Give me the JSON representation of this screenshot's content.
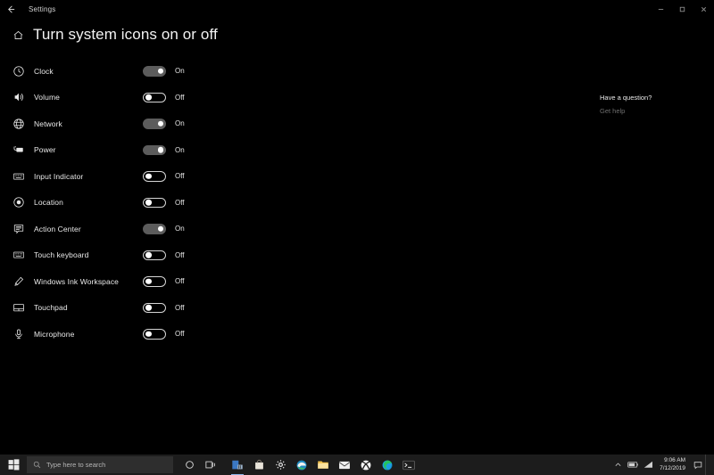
{
  "window": {
    "title": "Settings",
    "back_icon": "back-arrow-icon",
    "controls": [
      {
        "name": "minimize-button",
        "icon": "minimize-icon"
      },
      {
        "name": "maximize-button",
        "icon": "maximize-icon"
      },
      {
        "name": "close-button",
        "icon": "close-icon"
      }
    ]
  },
  "header": {
    "home_icon": "home-icon",
    "title": "Turn system icons on or off"
  },
  "settings": {
    "rows": [
      {
        "icon": "clock-icon",
        "label": "Clock",
        "state": "On",
        "on": true
      },
      {
        "icon": "volume-icon",
        "label": "Volume",
        "state": "Off",
        "on": false
      },
      {
        "icon": "network-globe-icon",
        "label": "Network",
        "state": "On",
        "on": true
      },
      {
        "icon": "power-battery-icon",
        "label": "Power",
        "state": "On",
        "on": true
      },
      {
        "icon": "keyboard-icon",
        "label": "Input Indicator",
        "state": "Off",
        "on": false
      },
      {
        "icon": "location-icon",
        "label": "Location",
        "state": "Off",
        "on": false
      },
      {
        "icon": "action-center-icon",
        "label": "Action Center",
        "state": "On",
        "on": true
      },
      {
        "icon": "touch-keyboard-icon",
        "label": "Touch keyboard",
        "state": "Off",
        "on": false
      },
      {
        "icon": "pen-icon",
        "label": "Windows Ink Workspace",
        "state": "Off",
        "on": false
      },
      {
        "icon": "touchpad-icon",
        "label": "Touchpad",
        "state": "Off",
        "on": false
      },
      {
        "icon": "microphone-icon",
        "label": "Microphone",
        "state": "Off",
        "on": false
      }
    ]
  },
  "help": {
    "title": "Have a question?",
    "link": "Get help"
  },
  "taskbar": {
    "start_icon": "windows-start-icon",
    "search_placeholder": "Type here to search",
    "cortana_icon": "cortana-icon",
    "taskview_icon": "task-view-icon",
    "apps": [
      {
        "name": "taskbar-store-icon",
        "icon": "microsoft-store-icon"
      },
      {
        "name": "taskbar-bag-icon",
        "icon": "shopping-bag-icon"
      },
      {
        "name": "taskbar-settings-icon",
        "icon": "gear-icon"
      },
      {
        "name": "taskbar-edge-legacy-icon",
        "icon": "edge-legacy-icon"
      },
      {
        "name": "taskbar-explorer-icon",
        "icon": "file-explorer-icon"
      },
      {
        "name": "taskbar-mail-icon",
        "icon": "mail-icon"
      },
      {
        "name": "taskbar-xbox-icon",
        "icon": "xbox-icon"
      },
      {
        "name": "taskbar-edge-icon",
        "icon": "edge-chromium-icon"
      },
      {
        "name": "taskbar-terminal-icon",
        "icon": "terminal-icon"
      }
    ],
    "tray": [
      {
        "name": "show-hidden-icons-button",
        "icon": "chevron-up-icon"
      },
      {
        "name": "battery-icon",
        "icon": "battery-icon"
      },
      {
        "name": "network-tray-icon",
        "icon": "network-icon"
      }
    ],
    "clock_time": "9:06 AM",
    "clock_date": "7/12/2019"
  },
  "colors": {
    "background": "#000000",
    "taskbar": "#1c1c1c",
    "toggle_on_track": "#5c5c5c",
    "text": "#e9e9e9",
    "link": "#6e6e6e",
    "running_underline": "#8ab4e8"
  }
}
